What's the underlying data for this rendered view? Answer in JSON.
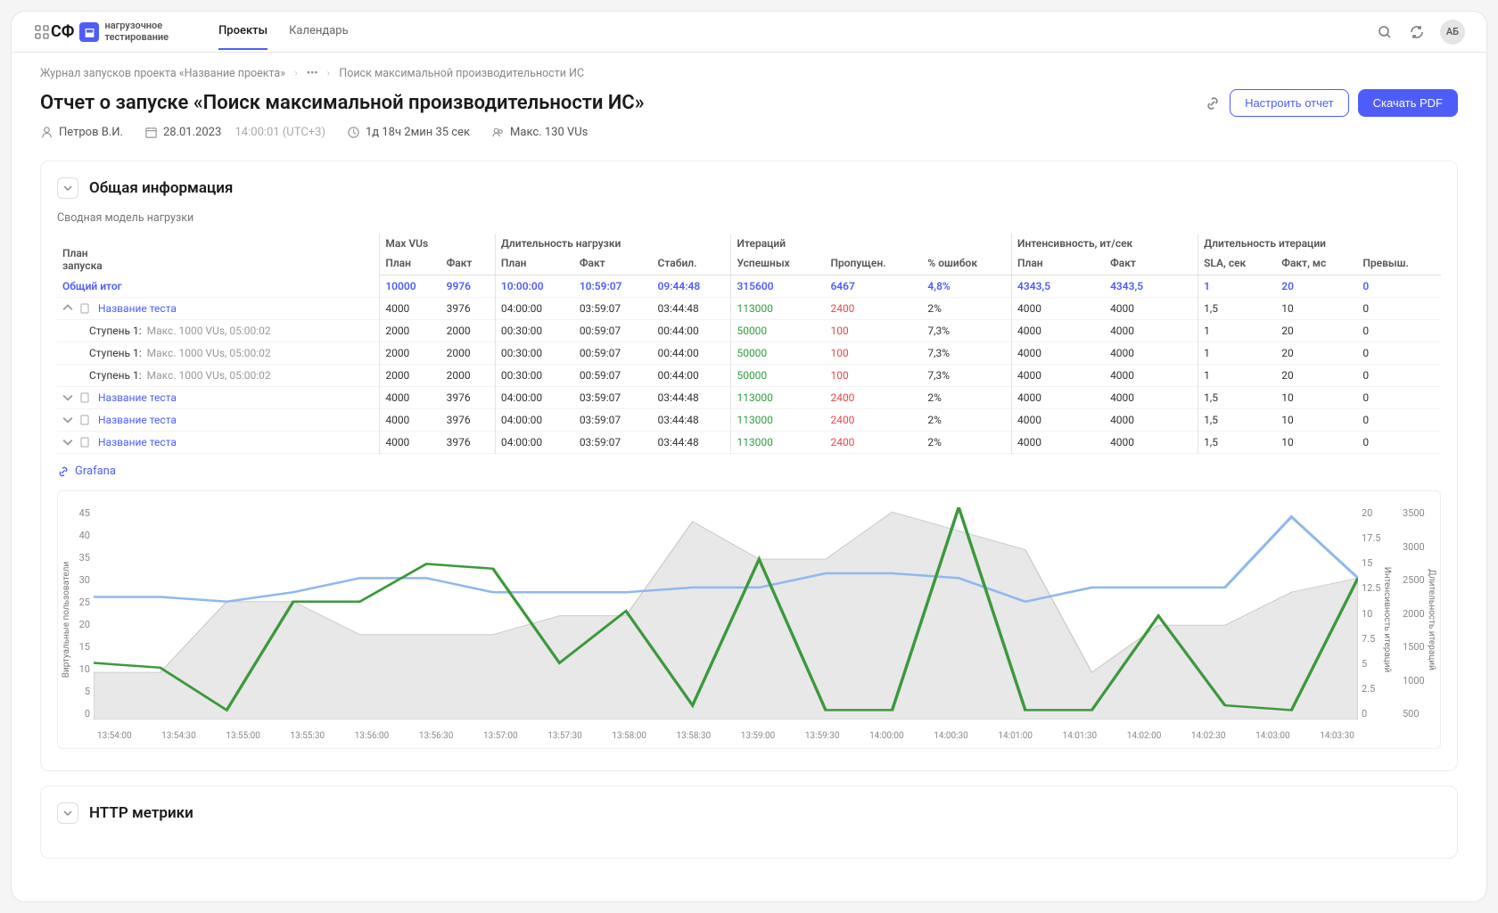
{
  "topbar": {
    "logo_mark": "СФ",
    "logo_text1": "нагрузочное",
    "logo_text2": "тестирование",
    "nav": {
      "projects": "Проекты",
      "calendar": "Календарь"
    },
    "avatar": "АБ"
  },
  "breadcrumb": {
    "item1": "Журнал запусков проекта «Название проекта»",
    "dots": "•••",
    "item3": "Поиск максимальной производительности ИС"
  },
  "title": "Отчет о запуске «Поиск максимальной производительности ИС»",
  "actions": {
    "configure": "Настроить отчет",
    "download": "Скачать PDF"
  },
  "meta": {
    "user": "Петров В.И.",
    "date": "28.01.2023",
    "time": "14:00:01 (UTC+3)",
    "duration": "1д 18ч 2мин 35 сек",
    "max_vus": "Макс. 130 VUs"
  },
  "section1": {
    "title": "Общая информация",
    "subtitle": "Сводная модель нагрузки"
  },
  "headers": {
    "plan_launch": "План\nзапуска",
    "max_vus": "Max VUs",
    "duration": "Длительность нагрузки",
    "iterations": "Итераций",
    "intensity": "Интенсивность, ит/сек",
    "iter_duration": "Длительность итерации",
    "plan": "План",
    "fact": "Факт",
    "stabil": "Стабил.",
    "success": "Успешных",
    "skipped": "Пропущен.",
    "err_pct": "% ошибок",
    "sla": "SLA, сек",
    "fact_ms": "Факт, мс",
    "exceed": "Превыш."
  },
  "rows": {
    "total": {
      "name": "Общий итог",
      "mvp": "10000",
      "mvf": "9976",
      "dp": "10:00:00",
      "df": "10:59:07",
      "ds": "09:44:48",
      "is": "315600",
      "ip": "6467",
      "ie": "4,8%",
      "np": "4343,5",
      "nf": "4343,5",
      "sla": "1",
      "fm": "20",
      "ex": "0"
    },
    "test1": {
      "name": "Название теста",
      "mvp": "4000",
      "mvf": "3976",
      "dp": "04:00:00",
      "df": "03:59:07",
      "ds": "03:44:48",
      "is": "113000",
      "ip": "2400",
      "ie": "2%",
      "np": "4000",
      "nf": "4000",
      "sla": "1,5",
      "fm": "10",
      "ex": "0"
    },
    "step": {
      "name": "Ступень 1:",
      "sub": "Макс. 1000 VUs,   05:00:02",
      "mvp": "2000",
      "mvf": "2000",
      "dp": "00:30:00",
      "df": "00:59:07",
      "ds": "00:44:00",
      "is": "50000",
      "ip": "100",
      "ie": "7,3%",
      "np": "4000",
      "nf": "4000",
      "sla": "1",
      "fm": "20",
      "ex": "0"
    }
  },
  "grafana": "Grafana",
  "section2": {
    "title": "HTTP метрики"
  },
  "chart_data": {
    "type": "line",
    "x": [
      "13:54:00",
      "13:54:30",
      "13:55:00",
      "13:55:30",
      "13:56:00",
      "13:56:30",
      "13:57:00",
      "13:57:30",
      "13:58:00",
      "13:58:30",
      "13:59:00",
      "13:59:30",
      "14:00:00",
      "14:00:30",
      "14:01:00",
      "14:01:30",
      "14:02:00",
      "14:02:30",
      "14:03:00",
      "14:03:30"
    ],
    "y_left": {
      "label": "Виртуальные пользователи",
      "ticks": [
        0,
        5,
        10,
        15,
        20,
        25,
        30,
        35,
        40,
        45
      ]
    },
    "y_right1": {
      "label": "Интенсивность итераций",
      "ticks": [
        0,
        2.5,
        5,
        7.5,
        10,
        12.5,
        15,
        17.5,
        20
      ]
    },
    "y_right2": {
      "label": "Длительность итераций",
      "ticks": [
        500,
        1000,
        1500,
        2000,
        2500,
        3000,
        3500
      ]
    },
    "series": [
      {
        "name": "area",
        "color": "#d6d6d6",
        "values": [
          10,
          10,
          25,
          25,
          18,
          18,
          18,
          22,
          22,
          42,
          34,
          34,
          44,
          40,
          36,
          10,
          20,
          20,
          27,
          30
        ]
      },
      {
        "name": "blue",
        "color": "#8fb8f0",
        "values": [
          26,
          26,
          25,
          27,
          30,
          30,
          27,
          27,
          27,
          28,
          28,
          31,
          31,
          30,
          25,
          28,
          28,
          28,
          43,
          30
        ]
      },
      {
        "name": "green",
        "color": "#3a9a3a",
        "values": [
          12,
          11,
          2,
          25,
          25,
          33,
          32,
          12,
          23,
          3,
          34,
          2,
          2,
          45,
          2,
          2,
          22,
          3,
          2,
          30
        ]
      }
    ]
  }
}
